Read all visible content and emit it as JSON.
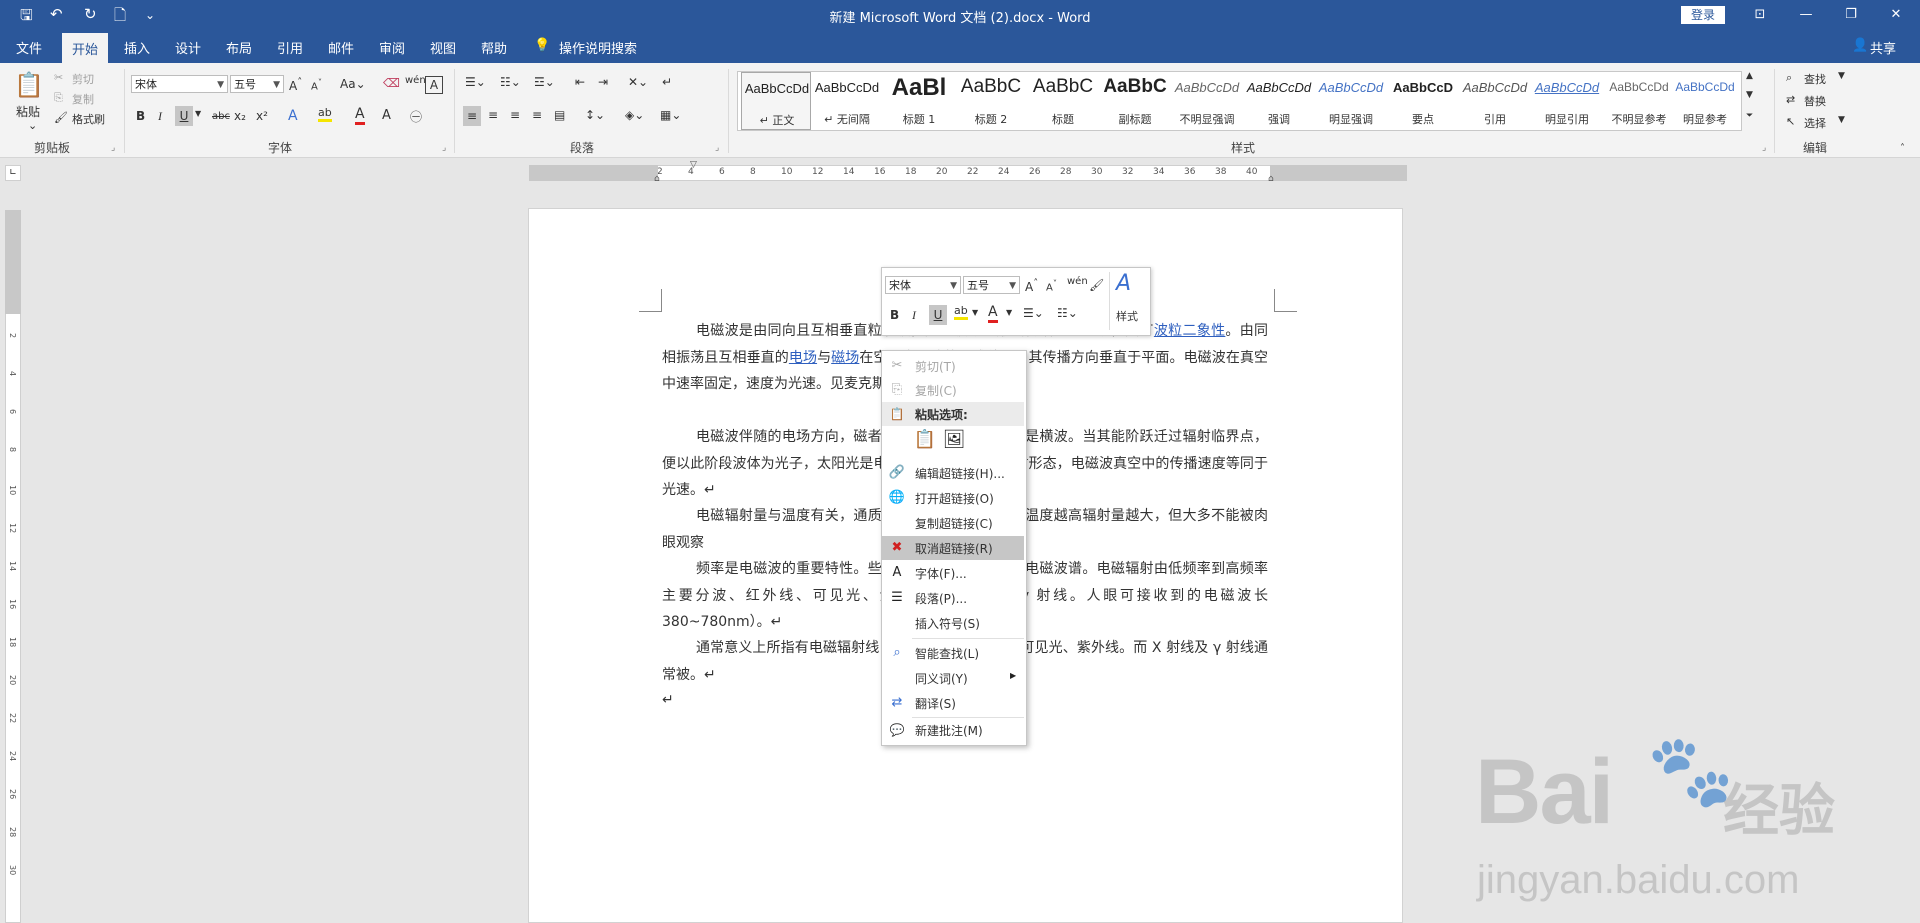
{
  "window": {
    "title": "新建 Microsoft Word 文档 (2).docx  -  Word",
    "login_label": "登录",
    "controls": {
      "restore_ribbon": "⊡",
      "minimize": "—",
      "maximize": "❐",
      "close": "✕"
    }
  },
  "quick_access": {
    "save": "🖫",
    "undo": "↶",
    "redo": "↻",
    "print_preview": "🗋",
    "customize": "⌄"
  },
  "tabs": [
    "文件",
    "开始",
    "插入",
    "设计",
    "布局",
    "引用",
    "邮件",
    "审阅",
    "视图",
    "帮助"
  ],
  "active_tab": "开始",
  "tell_me": "操作说明搜索",
  "share": "共享",
  "ribbon": {
    "clipboard": {
      "paste": "粘贴",
      "cut": "剪切",
      "copy": "复制",
      "format_painter": "格式刷",
      "label": "剪贴板"
    },
    "font": {
      "font_name": "宋体",
      "font_size": "五号",
      "label": "字体",
      "buttons": [
        "B",
        "I",
        "U",
        "abc",
        "x₂",
        "x²"
      ]
    },
    "paragraph": {
      "label": "段落"
    },
    "styles": {
      "label": "样式",
      "items": [
        {
          "preview": "AaBbCcDd",
          "name": "正文"
        },
        {
          "preview": "AaBbCcDd",
          "name": "无间隔"
        },
        {
          "preview": "AaBl",
          "name": "标题 1"
        },
        {
          "preview": "AaBbC",
          "name": "标题 2"
        },
        {
          "preview": "AaBbC",
          "name": "标题"
        },
        {
          "preview": "AaBbC",
          "name": "副标题"
        },
        {
          "preview": "AaBbCcDd",
          "name": "不明显强调"
        },
        {
          "preview": "AaBbCcDd",
          "name": "强调"
        },
        {
          "preview": "AaBbCcDd",
          "name": "明显强调"
        },
        {
          "preview": "AaBbCcD",
          "name": "要点"
        },
        {
          "preview": "AaBbCcDd",
          "name": "引用"
        },
        {
          "preview": "AaBbCcDd",
          "name": "明显引用"
        },
        {
          "preview": "AaBbCcDd",
          "name": "不明显参考"
        },
        {
          "preview": "AaBbCcDd",
          "name": "明显参考"
        }
      ]
    },
    "editing": {
      "find": "查找",
      "replace": "替换",
      "select": "选择",
      "label": "编辑"
    }
  },
  "ruler": {
    "horizontal": [
      "8",
      "6",
      "4",
      "2",
      "2",
      "4",
      "6",
      "8",
      "10",
      "12",
      "14",
      "16",
      "18",
      "20",
      "22",
      "24",
      "26",
      "28",
      "30",
      "32",
      "34",
      "36",
      "38",
      "40",
      "42",
      "44",
      "46",
      "48"
    ],
    "vertical": [
      "1",
      "2",
      "1",
      "2",
      "4",
      "6",
      "8",
      "10",
      "12",
      "14",
      "16",
      "18",
      "20",
      "22",
      "24",
      "26",
      "28",
      "30"
    ]
  },
  "document": {
    "paragraphs": [
      [
        {
          "t": "电磁波是由同向且互相垂直"
        },
        {
          "t": "粒子波，是以波动的形式传播的电磁场，具有"
        },
        {
          "t": "波粒二象性",
          "link": true
        },
        {
          "t": "。由同相振荡且互相垂直的"
        },
        {
          "t": "电场",
          "link": true
        },
        {
          "t": "与"
        },
        {
          "t": "磁场",
          "link": true
        },
        {
          "t": "在空间中以波的形式移动，其传播方向垂直于"
        },
        {
          "t": "平面。电磁波在真空中速率固定，速度为光速。见麦克斯韦方程组。↵"
        }
      ],
      [
        {
          "t": "电磁波伴随的电场方向，磁"
        },
        {
          "t": "者互相垂直，因此电磁波是横波。当其能阶跃迁过辐射临界点，便以"
        },
        {
          "t": "此阶段波体为光子，太阳光是电磁波的一种可见的辐射形态，电磁波"
        },
        {
          "t": "真空中的传播速度等同于光速。↵"
        }
      ],
      [
        {
          "t": "电磁辐射量与温度有关，通"
        },
        {
          "t": "质或粒子都有电磁辐射，温度越高辐射量越大，但大多不能被肉眼观察"
        }
      ],
      [
        {
          "t": "频率是电磁波的重要特性。"
        },
        {
          "t": "些电磁波排列起来，就是电磁波谱。电磁辐射由低频率到高频率主要分"
        },
        {
          "t": "波、红外线、可见光、紫外线、X 射线和 γ 射线。人眼可接收到的电磁"
        },
        {
          "t": "波长 380~780nm）。↵"
        }
      ],
      [
        {
          "t": "通常意义上所指有电磁辐射"
        },
        {
          "t": "线电波、微波、红外线、可见光、紫外线。而 X 射线及 γ 射线通常被"
        },
        {
          "t": "。↵"
        }
      ],
      [
        {
          "t": "↵"
        }
      ]
    ]
  },
  "mini_toolbar": {
    "font_name": "宋体",
    "font_size": "五号",
    "styles_label": "样式"
  },
  "context_menu": [
    {
      "label": "剪切(T)",
      "icon": "✂",
      "state": "disabled"
    },
    {
      "label": "复制(C)",
      "icon": "⎘",
      "state": "disabled"
    },
    {
      "label": "粘贴选项:",
      "icon": "📋",
      "state": "header"
    },
    {
      "label": "",
      "icon": "",
      "state": "paste-options"
    },
    {
      "label": "编辑超链接(H)...",
      "icon": "🔗",
      "state": "normal"
    },
    {
      "label": "打开超链接(O)",
      "icon": "🌐",
      "state": "normal"
    },
    {
      "label": "复制超链接(C)",
      "icon": "",
      "state": "normal"
    },
    {
      "label": "取消超链接(R)",
      "icon": "✖",
      "state": "highlighted"
    },
    {
      "label": "字体(F)...",
      "icon": "A",
      "state": "normal"
    },
    {
      "label": "段落(P)...",
      "icon": "☰",
      "state": "normal"
    },
    {
      "label": "插入符号(S)",
      "icon": "",
      "state": "normal"
    },
    {
      "label": "智能查找(L)",
      "icon": "⌕",
      "state": "normal"
    },
    {
      "label": "同义词(Y)",
      "icon": "",
      "state": "submenu"
    },
    {
      "label": "翻译(S)",
      "icon": "⇄",
      "state": "normal"
    },
    {
      "label": "新建批注(M)",
      "icon": "💬",
      "state": "normal"
    }
  ],
  "watermark": {
    "logo": "Bai",
    "paw": "du",
    "brand_cn": "经验",
    "url": "jingyan.baidu.com"
  },
  "colors": {
    "brand": "#2b579a",
    "link": "#2e5fbf",
    "highlight_menu": "#c6c6c6",
    "font_red": "#e02020",
    "highlight_yellow": "#f5e500"
  }
}
